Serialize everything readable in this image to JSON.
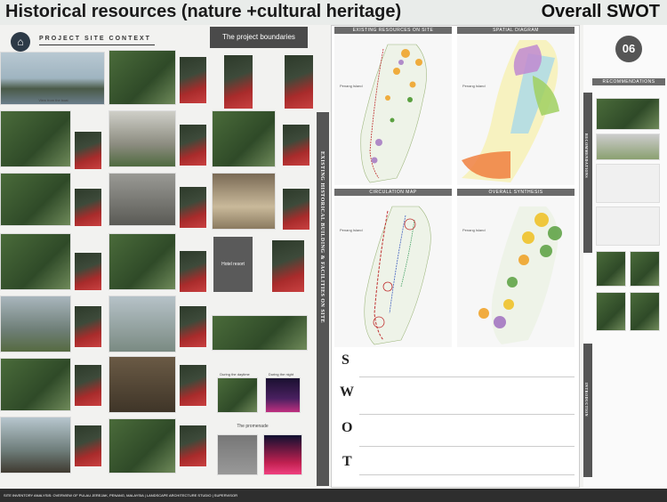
{
  "title": "Historical resources (nature +cultural heritage)",
  "title_right": "Overall SWOT",
  "left": {
    "section_label": "PROJECT SITE CONTEXT",
    "project_boundaries": "The project boundaries",
    "vertical_label": "EXISTING HISTORICAL BUILDING & FACILITIES ON SITE",
    "hotel_resort": "Hotel resort",
    "promenade": "The promenade",
    "captions": {
      "view": "View from the boat",
      "during_day": "During the daytime",
      "during_night": "During the night"
    }
  },
  "right": {
    "panels": {
      "existing": "EXISTING RESOURCES ON SITE",
      "spatial": "SPATIAL DIAGRAM",
      "circulation": "CIRCULATION MAP",
      "synthesis": "OVERALL SYNTHESIS"
    },
    "island_label": "Penang Island",
    "swot": [
      "S",
      "W",
      "O",
      "T"
    ],
    "badge": "06",
    "recommendations": "RECOMMENDATIONS",
    "side_label_1": "RECOMMENDATIONS",
    "side_label_2": "INTRODUCTION",
    "colors": {
      "accent_orange": "#f0a020",
      "accent_purple": "#a070c0",
      "accent_green": "#5aa040",
      "dark": "#555555"
    }
  },
  "footer": "SITE INVENTORY ANALYSIS: OVERVIEW OF PULAU JEREJAK, PENANG, MALAYSIA | LANDSCAPE ARCHITECTURE STUDIO | SUPERVISOR"
}
